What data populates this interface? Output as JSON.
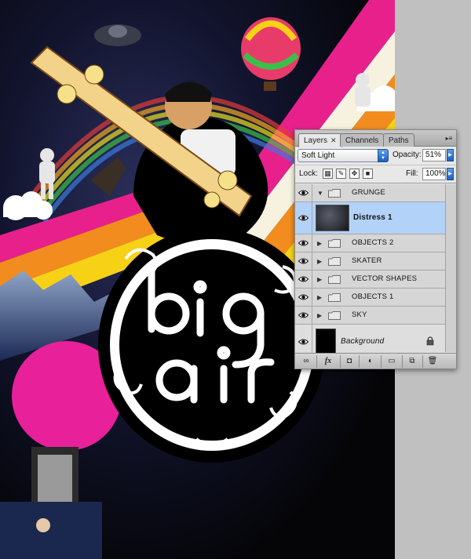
{
  "artwork": {
    "title_letters": "big air",
    "colors": {
      "sky": "#07070f",
      "magenta": "#e8208c",
      "orange": "#f28c1e",
      "yellow": "#f7d116",
      "pink_circle": "#e8209a",
      "right_margin": "#c0c0c0"
    }
  },
  "layers_panel": {
    "tabs": [
      {
        "label": "Layers",
        "active": true,
        "close": "✕"
      },
      {
        "label": "Channels",
        "active": false
      },
      {
        "label": "Paths",
        "active": false
      }
    ],
    "menu_icon": "panel-menu-icon",
    "blend_mode": "Soft Light",
    "opacity_label": "Opacity:",
    "opacity_value": "51%",
    "lock_label": "Lock:",
    "fill_label": "Fill:",
    "fill_value": "100%",
    "layers": [
      {
        "name": "GRUNGE",
        "type": "group",
        "expanded": true,
        "visible": true
      },
      {
        "name": "Distress 1",
        "type": "layer",
        "selected": true,
        "visible": true
      },
      {
        "name": "OBJECTS 2",
        "type": "group",
        "expanded": false,
        "visible": true
      },
      {
        "name": "SKATER",
        "type": "group",
        "expanded": false,
        "visible": true
      },
      {
        "name": "VECTOR SHAPES",
        "type": "group",
        "expanded": false,
        "visible": true
      },
      {
        "name": "OBJECTS 1",
        "type": "group",
        "expanded": false,
        "visible": true
      },
      {
        "name": "SKY",
        "type": "group",
        "expanded": false,
        "visible": true
      },
      {
        "name": "Background",
        "type": "background",
        "locked": true,
        "visible": true
      }
    ],
    "footer_buttons": {
      "link": "link-icon",
      "fx": "fx",
      "mask": "layer-mask-icon",
      "adjustment": "adjustment-layer-icon",
      "group": "new-group-icon",
      "new_layer": "new-layer-icon",
      "trash": "trash-icon"
    }
  }
}
